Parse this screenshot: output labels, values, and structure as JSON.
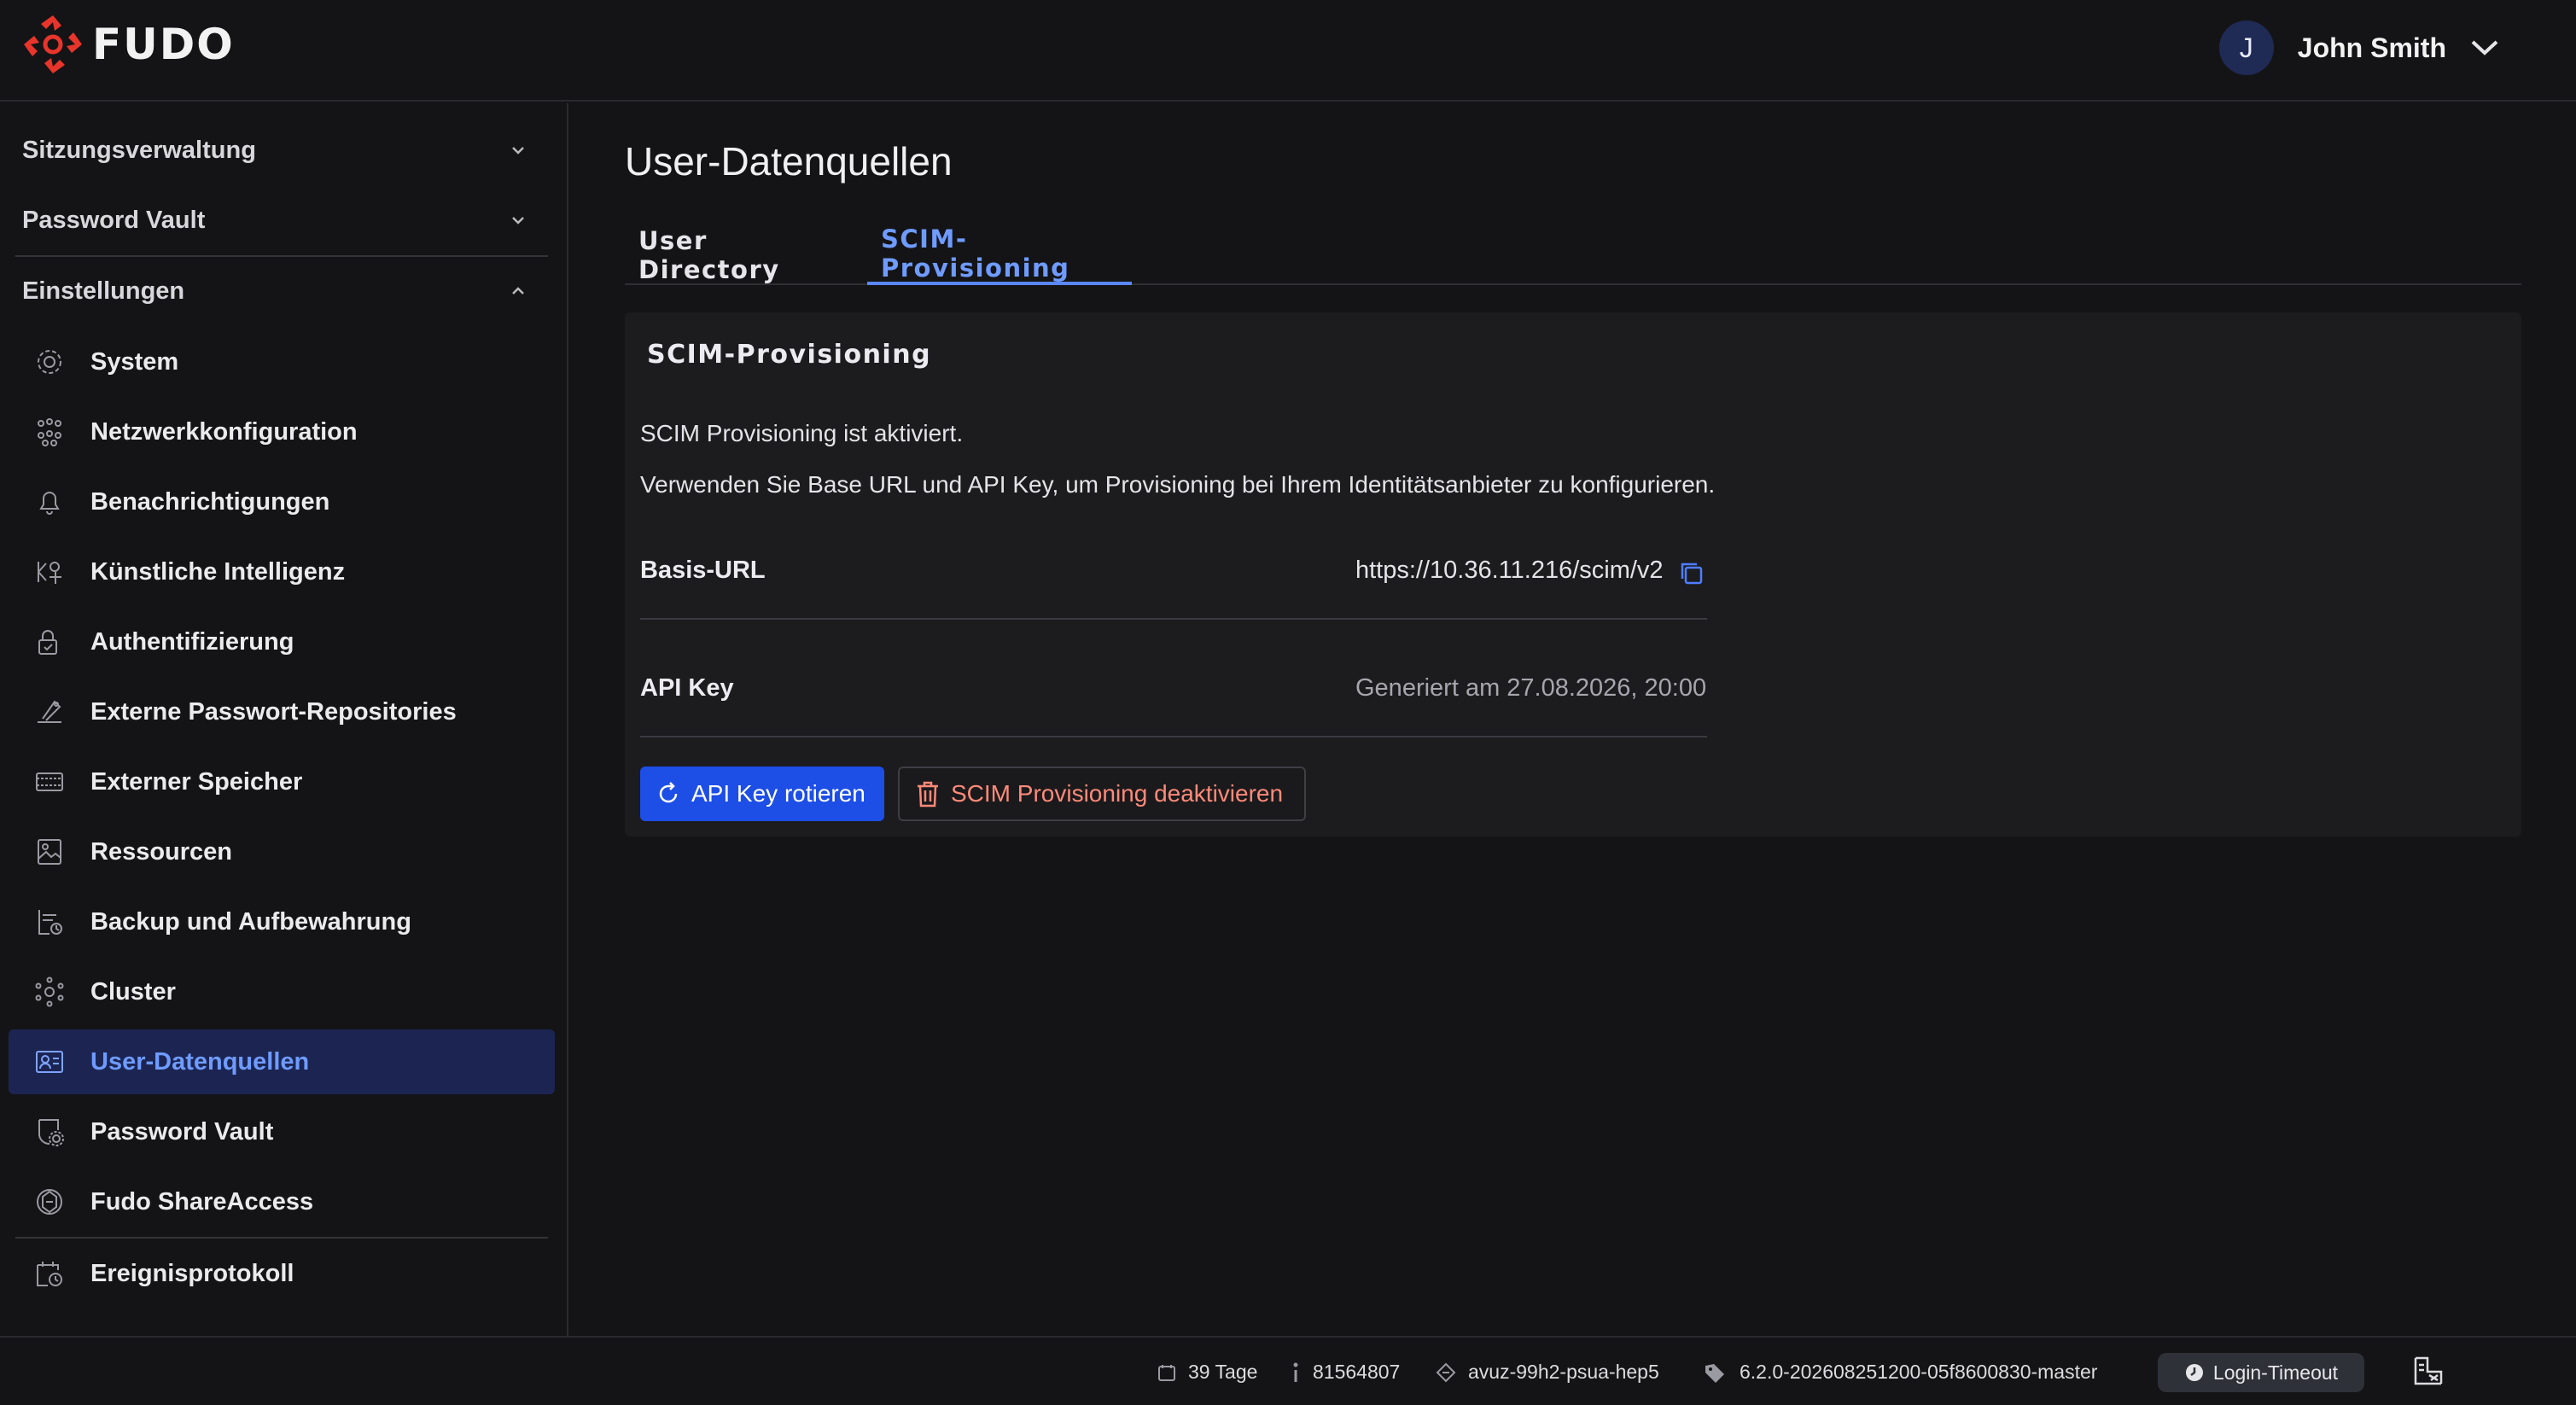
{
  "app": {
    "brand": "FUDO",
    "accent": "#1d4ee6",
    "danger": "#ff8a7a"
  },
  "user": {
    "initial": "J",
    "name": "John Smith"
  },
  "sidebar": {
    "sections": [
      {
        "label": "Sitzungsverwaltung",
        "expanded": false
      },
      {
        "label": "Password Vault",
        "expanded": false
      },
      {
        "label": "Einstellungen",
        "expanded": true
      }
    ],
    "items": [
      {
        "label": "System",
        "icon": "gear-icon"
      },
      {
        "label": "Netzwerkkonfiguration",
        "icon": "network-icon"
      },
      {
        "label": "Benachrichtigungen",
        "icon": "bell-icon"
      },
      {
        "label": "Künstliche Intelligenz",
        "icon": "ai-icon"
      },
      {
        "label": "Authentifizierung",
        "icon": "lock-icon"
      },
      {
        "label": "Externe Passwort-Repositories",
        "icon": "repository-icon"
      },
      {
        "label": "Externer Speicher",
        "icon": "storage-icon"
      },
      {
        "label": "Ressourcen",
        "icon": "image-icon"
      },
      {
        "label": "Backup und Aufbewahrung",
        "icon": "backup-icon"
      },
      {
        "label": "Cluster",
        "icon": "cluster-icon"
      },
      {
        "label": "User-Datenquellen",
        "icon": "user-card-icon",
        "active": true
      },
      {
        "label": "Password Vault",
        "icon": "shield-gear-icon"
      },
      {
        "label": "Fudo ShareAccess",
        "icon": "share-access-icon"
      }
    ],
    "bottom_item": {
      "label": "Ereignisprotokoll",
      "icon": "calendar-clock-icon"
    }
  },
  "main": {
    "title": "User-Datenquellen",
    "tabs": [
      {
        "label": "User Directory",
        "active": false
      },
      {
        "label": "SCIM-Provisioning",
        "active": true
      }
    ],
    "card": {
      "title": "SCIM-Provisioning",
      "status_text": "SCIM Provisioning ist aktiviert.",
      "hint_text": "Verwenden Sie Base URL und API Key, um Provisioning bei Ihrem Identitätsanbieter zu konfigurieren.",
      "fields": [
        {
          "label": "Basis-URL",
          "value": "https://10.36.11.216/scim/v2"
        },
        {
          "label": "API Key",
          "value": "Generiert am 27.08.2026, 20:00"
        }
      ],
      "buttons": {
        "rotate": "API Key rotieren",
        "deactivate": "SCIM Provisioning deaktivieren"
      }
    }
  },
  "footer": {
    "days": "39 Tage",
    "id": "81564807",
    "host": "avuz-99h2-psua-hep5",
    "version": "6.2.0-202608251200-05f8600830-master",
    "login_timeout": "Login-Timeout"
  }
}
